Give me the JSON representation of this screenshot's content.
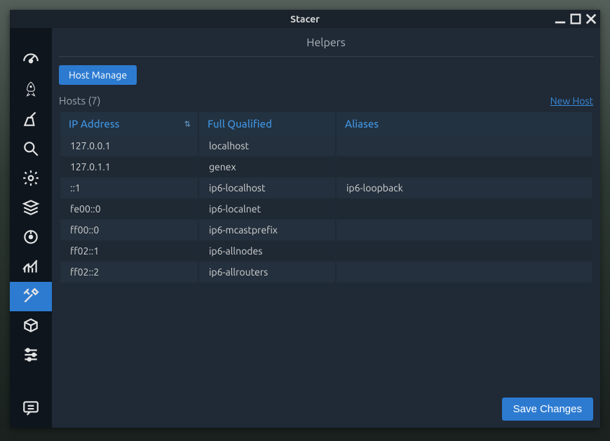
{
  "window": {
    "title": "Stacer"
  },
  "page": {
    "title": "Helpers"
  },
  "tabs": {
    "host_manage": "Host Manage"
  },
  "hosts": {
    "label": "Hosts (7)",
    "new_link": "New Host",
    "columns": {
      "ip": "IP Address",
      "fq": "Full Qualified",
      "al": "Aliases"
    },
    "rows": [
      {
        "ip": "127.0.0.1",
        "fq": "localhost",
        "al": ""
      },
      {
        "ip": "127.0.1.1",
        "fq": "genex",
        "al": ""
      },
      {
        "ip": "::1",
        "fq": "ip6-localhost",
        "al": "ip6-loopback"
      },
      {
        "ip": "fe00::0",
        "fq": "ip6-localnet",
        "al": ""
      },
      {
        "ip": "ff00::0",
        "fq": "ip6-mcastprefix",
        "al": ""
      },
      {
        "ip": "ff02::1",
        "fq": "ip6-allnodes",
        "al": ""
      },
      {
        "ip": "ff02::2",
        "fq": "ip6-allrouters",
        "al": ""
      }
    ]
  },
  "buttons": {
    "save": "Save Changes"
  },
  "sidebar": {
    "items": [
      {
        "name": "dashboard"
      },
      {
        "name": "startup"
      },
      {
        "name": "cleaner"
      },
      {
        "name": "search"
      },
      {
        "name": "services"
      },
      {
        "name": "processes"
      },
      {
        "name": "uninstaller"
      },
      {
        "name": "resources"
      },
      {
        "name": "helpers",
        "active": true
      },
      {
        "name": "apt-repos"
      },
      {
        "name": "settings"
      }
    ],
    "footer_item": {
      "name": "feedback"
    }
  }
}
